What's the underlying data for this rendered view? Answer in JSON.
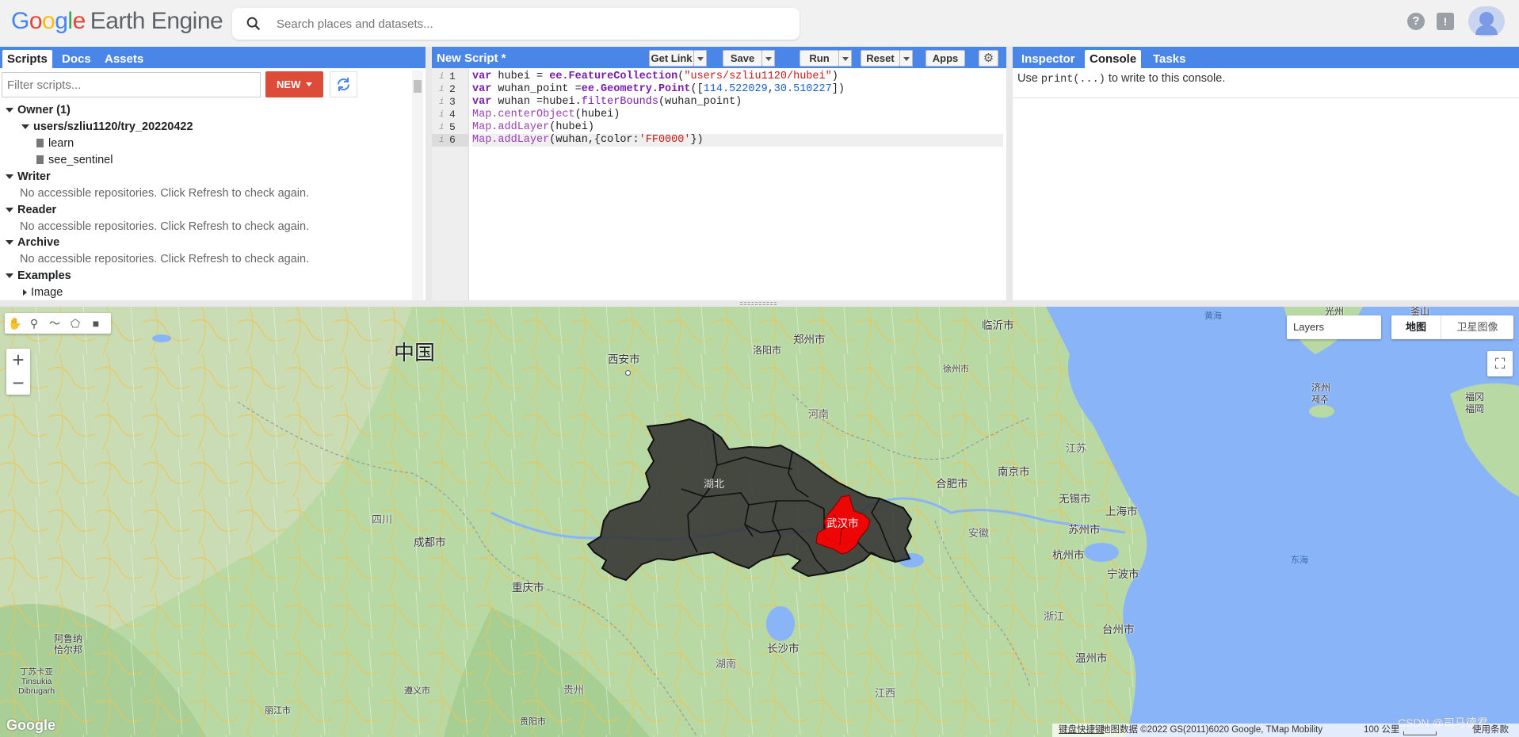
{
  "header": {
    "logo_google": "Google",
    "logo_product": "Earth Engine",
    "search_placeholder": "Search places and datasets..."
  },
  "left_panel": {
    "tabs": [
      "Scripts",
      "Docs",
      "Assets"
    ],
    "filter_placeholder": "Filter scripts...",
    "new_button": "NEW",
    "tree": {
      "owner": "Owner (1)",
      "repo": "users/szliu1120/try_20220422",
      "files": [
        "learn",
        "see_sentinel"
      ],
      "writer": "Writer",
      "writer_msg": "No accessible repositories. Click Refresh to check again.",
      "reader": "Reader",
      "reader_msg": "No accessible repositories. Click Refresh to check again.",
      "archive": "Archive",
      "archive_msg": "No accessible repositories. Click Refresh to check again.",
      "examples": "Examples",
      "image": "Image"
    }
  },
  "editor": {
    "title": "New Script *",
    "buttons": {
      "get_link": "Get Link",
      "save": "Save",
      "run": "Run",
      "reset": "Reset",
      "apps": "Apps"
    },
    "line_numbers": [
      "1",
      "2",
      "3",
      "4",
      "5",
      "6"
    ],
    "code": {
      "l1": {
        "a": "var",
        "b": " hubei = ",
        "c": "ee.FeatureCollection",
        "d": "(",
        "e": "\"users/szliu1120/hubei\"",
        "f": ")"
      },
      "l2": {
        "a": "var",
        "b": " wuhan_point =",
        "c": "ee.Geometry.Point",
        "d": "([",
        "e": "114.522029",
        "f": ",",
        "g": "30.510227",
        "h": "])"
      },
      "l3": {
        "a": "var",
        "b": " wuhan =hubei.",
        "c": "filterBounds",
        "d": "(wuhan_point)"
      },
      "l4": {
        "a": "Map.centerObject",
        "b": "(hubei)"
      },
      "l5": {
        "a": "Map.addLayer",
        "b": "(hubei)"
      },
      "l6": {
        "a": "Map.addLayer",
        "b": "(wuhan,{color:",
        "c": "'FF0000'",
        "d": "})"
      }
    }
  },
  "right_panel": {
    "tabs": [
      "Inspector",
      "Console",
      "Tasks"
    ],
    "console_pre": "Use ",
    "console_code": "print(...)",
    "console_post": " to write to this console."
  },
  "map": {
    "labels": {
      "china": "中国",
      "xian": "西安市",
      "zhengzhou": "郑州市",
      "luoyang": "洛阳市",
      "linyi": "临沂市",
      "xuzhou": "徐州市",
      "henan": "河南",
      "jiangsu": "江苏",
      "hubei": "湖北",
      "wuhan": "武汉市",
      "hefei": "合肥市",
      "nanjing": "南京市",
      "wuxi": "无锡市",
      "shanghai": "上海市",
      "suzhou": "苏州市",
      "anhui": "安徽",
      "hangzhou": "杭州市",
      "ningbo": "宁波市",
      "zhejiang": "浙江",
      "taizhou": "台州市",
      "wenzhou": "温州市",
      "sichuan": "四川",
      "chengdu": "成都市",
      "chongqing": "重庆市",
      "changsha": "长沙市",
      "hunan": "湖南",
      "guizhou": "贵州",
      "jiangxi": "江西",
      "zunyi": "遵义市",
      "guiyang": "贵阳市",
      "lijiang": "丽江市",
      "aba": "阿鲁纳\n恰尔邦",
      "dibrugarh": "丁苏卡亚\nTinsukia\nDibrugarh",
      "donghai": "东海",
      "huanghai": "黄海",
      "jeju": "济州\n제주",
      "fukuoka": "福冈\n福岡",
      "gwangju": "光州",
      "jinshan": "釜山"
    },
    "layers_label": "Layers",
    "map_type": [
      "地图",
      "卫星图像"
    ],
    "google_logo": "Google",
    "attribution": {
      "shortcuts": "键盘快捷键",
      "data": "地图数据 ©2022 GS(2011)6020 Google, TMap Mobility",
      "scale": "100 公里",
      "terms": "使用条款"
    },
    "watermark": "CSDN @司马德君"
  },
  "colors": {
    "accent": "#4a86e8",
    "new_button": "#dd4b39",
    "hubei_fill": "#333333",
    "wuhan_fill": "#ff0000",
    "water": "#8ab4f8"
  }
}
